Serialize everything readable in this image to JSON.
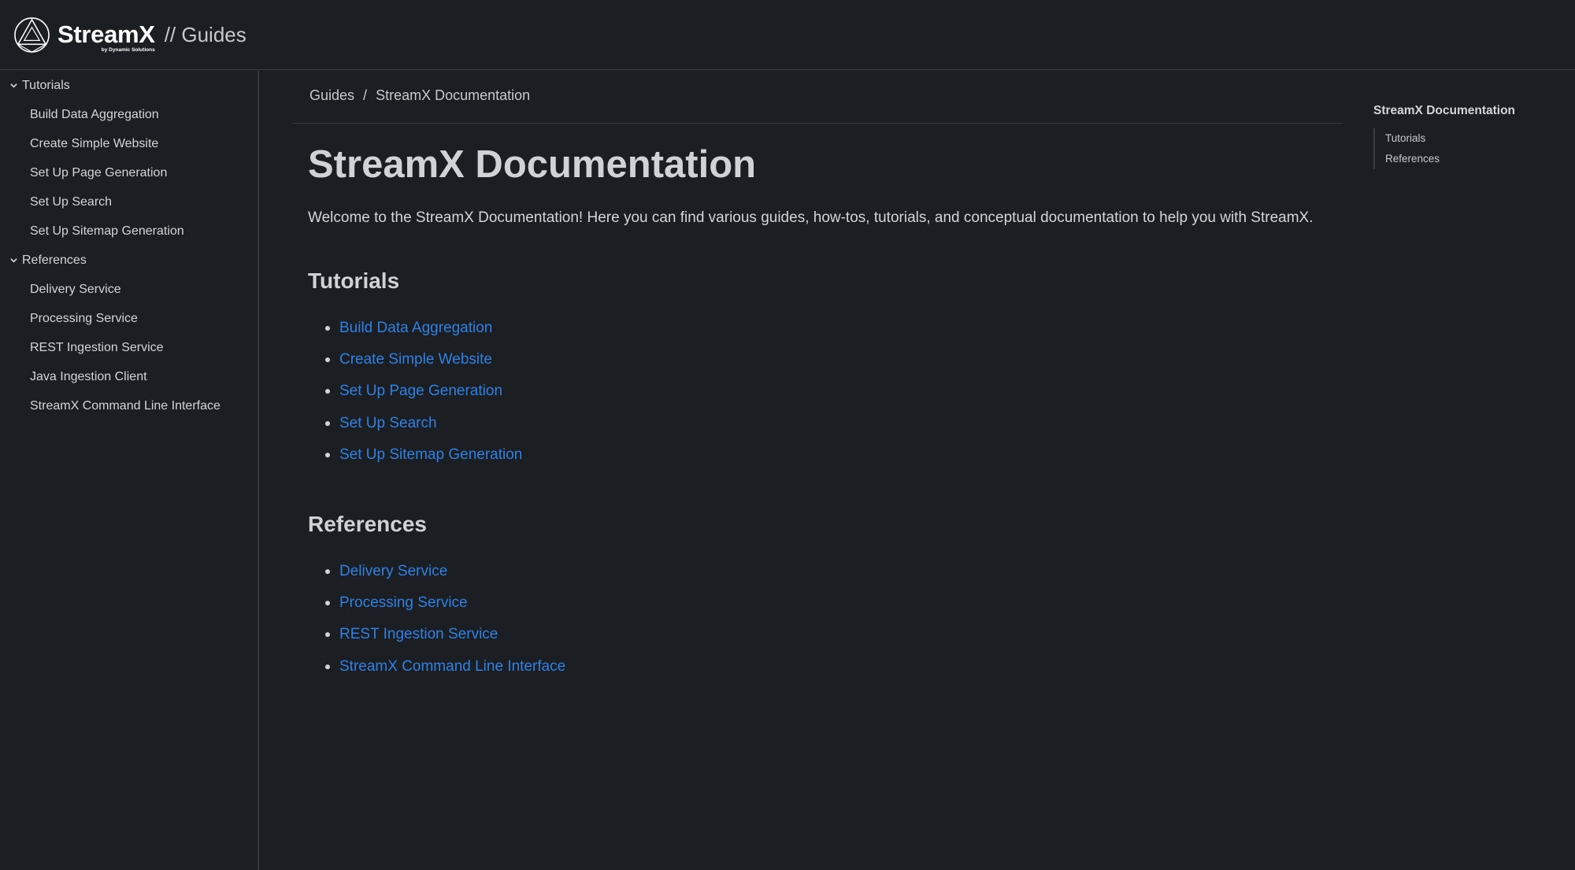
{
  "header": {
    "brand_name": "StreamX",
    "brand_sub": "by Dynamic Solutions",
    "section_label": "// Guides"
  },
  "sidebar": {
    "groups": [
      {
        "label": "Tutorials",
        "items": [
          {
            "label": "Build Data Aggregation"
          },
          {
            "label": "Create Simple Website"
          },
          {
            "label": "Set Up Page Generation"
          },
          {
            "label": "Set Up Search"
          },
          {
            "label": "Set Up Sitemap Generation"
          }
        ]
      },
      {
        "label": "References",
        "items": [
          {
            "label": "Delivery Service"
          },
          {
            "label": "Processing Service"
          },
          {
            "label": "REST Ingestion Service"
          },
          {
            "label": "Java Ingestion Client"
          },
          {
            "label": "StreamX Command Line Interface"
          }
        ]
      }
    ]
  },
  "breadcrumb": {
    "parent": "Guides",
    "separator": "/",
    "current": "StreamX Documentation"
  },
  "main": {
    "title": "StreamX Documentation",
    "intro": "Welcome to the StreamX Documentation! Here you can find various guides, how-tos, tutorials, and conceptual documentation to help you with StreamX.",
    "sections": [
      {
        "title": "Tutorials",
        "links": [
          "Build Data Aggregation",
          "Create Simple Website",
          "Set Up Page Generation",
          "Set Up Search",
          "Set Up Sitemap Generation"
        ]
      },
      {
        "title": "References",
        "links": [
          "Delivery Service",
          "Processing Service",
          "REST Ingestion Service",
          "StreamX Command Line Interface"
        ]
      }
    ]
  },
  "toc": {
    "title": "StreamX Documentation",
    "items": [
      "Tutorials",
      "References"
    ]
  },
  "colors": {
    "background": "#1b1e22",
    "link": "#2f81e3",
    "text": "#d3d5d8",
    "border": "#3a3d42"
  }
}
